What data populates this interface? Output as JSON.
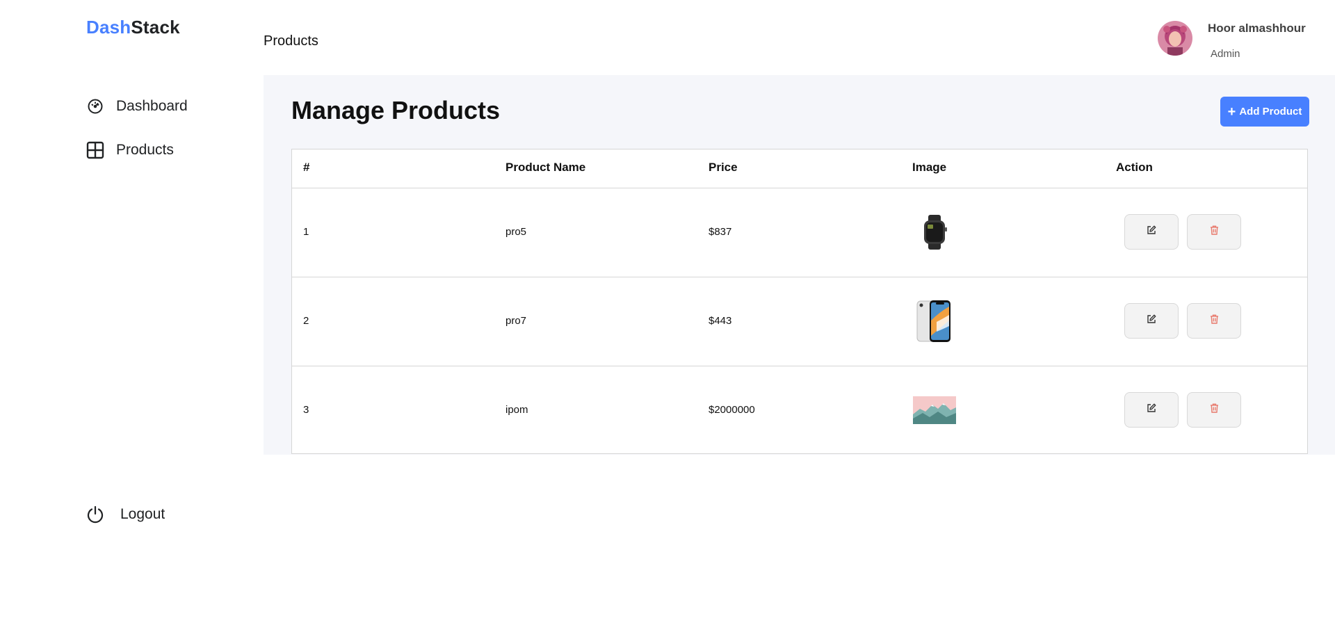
{
  "brand": {
    "part1": "Dash",
    "part2": "Stack",
    "accent": "#4880FF"
  },
  "sidebar": {
    "items": [
      {
        "label": "Dashboard",
        "icon": "speedometer-icon"
      },
      {
        "label": "Products",
        "icon": "grid-icon"
      }
    ],
    "logout": {
      "label": "Logout",
      "icon": "power-icon"
    }
  },
  "topbar": {
    "title": "Products"
  },
  "user": {
    "name": "Hoor almashhour",
    "role": "Admin"
  },
  "main": {
    "title": "Manage Products",
    "add_button": "Add Product",
    "table": {
      "columns": [
        "#",
        "Product Name",
        "Price",
        "Image",
        "Action"
      ],
      "rows": [
        {
          "id": "1",
          "name": "pro5",
          "price": "$837",
          "image": "smartwatch-image"
        },
        {
          "id": "2",
          "name": "pro7",
          "price": "$443",
          "image": "smartphone-image"
        },
        {
          "id": "3",
          "name": "ipom",
          "price": "$2000000",
          "image": "mountain-landscape-image"
        }
      ]
    }
  },
  "colors": {
    "delete": "#E8786A",
    "main_bg": "#F5F6FA"
  }
}
